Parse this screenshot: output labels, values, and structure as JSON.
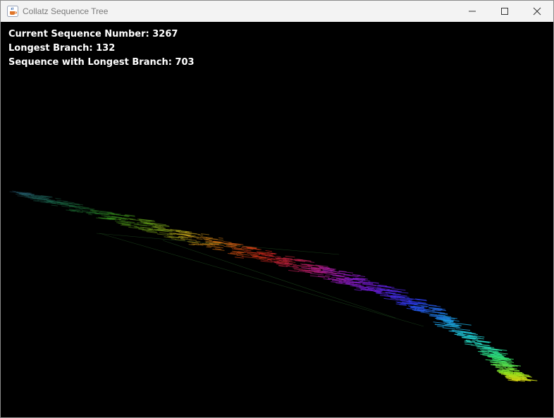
{
  "window": {
    "title": "Collatz Sequence Tree",
    "app_icon": "java-cup-icon",
    "controls": [
      "minimize-icon",
      "maximize-icon",
      "close-icon"
    ]
  },
  "stats": {
    "current_label": "Current Sequence Number:",
    "current_value": "3267",
    "longest_label": "Longest Branch:",
    "longest_value": "132",
    "longest_seq_label": "Sequence with Longest Branch:",
    "longest_seq_value": "703"
  },
  "visualization": {
    "type": "collatz-tree",
    "colors": [
      "#2c5d7a",
      "#1f6f5f",
      "#1f7a3a",
      "#3c9a1c",
      "#7fb21c",
      "#c8a01a",
      "#e06a12",
      "#e02a1c",
      "#c0205a",
      "#9a1cb8",
      "#6a1ce0",
      "#2a3cf0",
      "#1a9ae0",
      "#22d0c8",
      "#30e070",
      "#8ae020",
      "#d8d010"
    ],
    "background": "#000000"
  }
}
